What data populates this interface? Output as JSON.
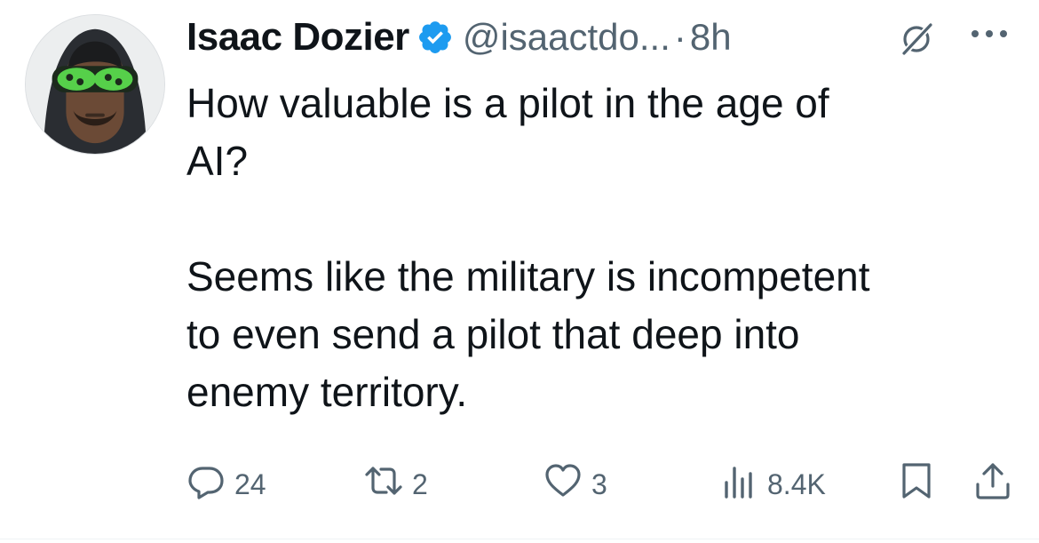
{
  "author": {
    "name": "Isaac Dozier",
    "handle": "@isaactdo...",
    "separator": "·",
    "time": "8h",
    "verified_color": "#1d9bf0"
  },
  "tweet": {
    "text": "How valuable is a pilot in the age of\nAI?\n\nSeems like the military is incompetent\nto even send a pilot that deep into\nenemy territory."
  },
  "actions": {
    "replies": "24",
    "reposts": "2",
    "likes": "3",
    "views": "8.4K"
  },
  "icons": {
    "verified": "verified-badge-icon",
    "grok": "grok-icon",
    "more": "more-options-icon",
    "reply": "reply-icon",
    "repost": "repost-icon",
    "like": "heart-icon",
    "views": "views-icon",
    "bookmark": "bookmark-icon",
    "share": "share-icon"
  },
  "colors": {
    "text": "#0f1419",
    "secondary": "#536471",
    "accent": "#1d9bf0"
  }
}
